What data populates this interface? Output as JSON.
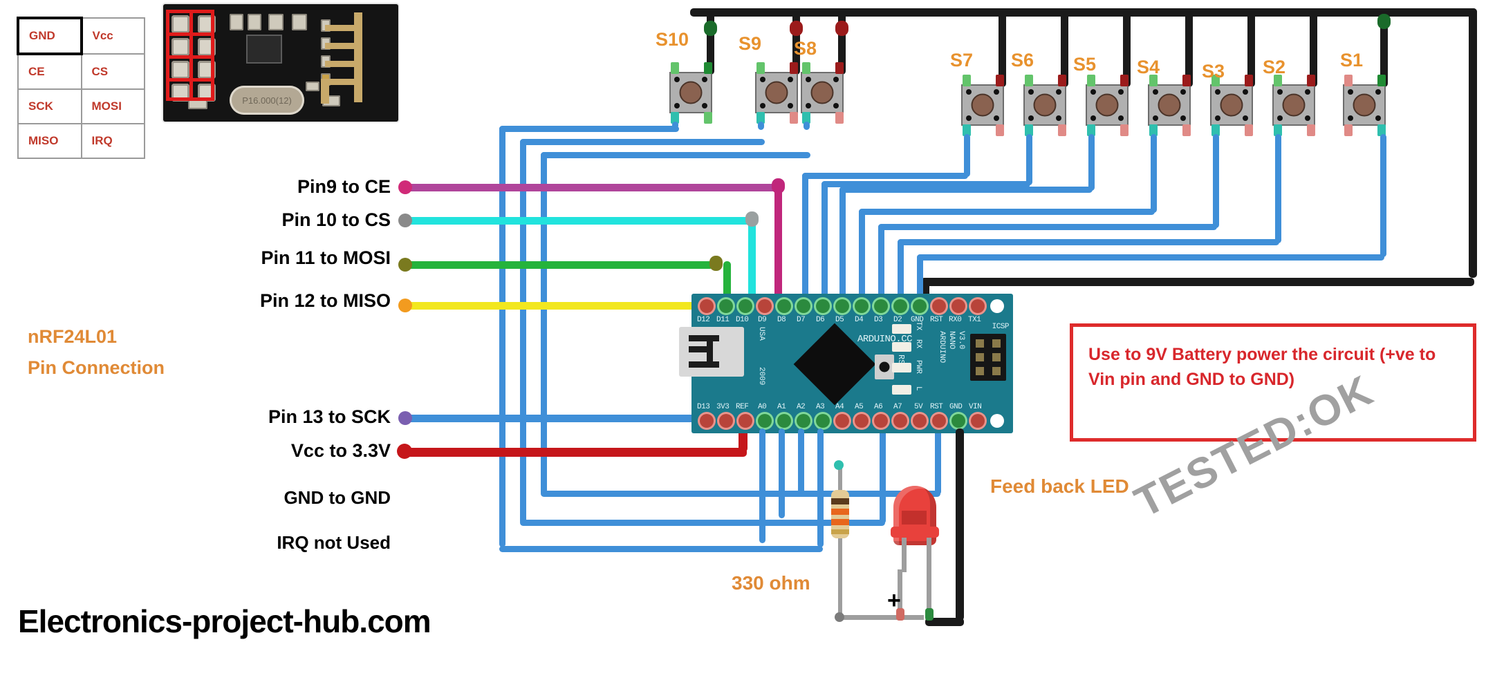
{
  "pin_table": {
    "rows": [
      [
        "GND",
        "Vcc"
      ],
      [
        "CE",
        "CS"
      ],
      [
        "SCK",
        "MOSI"
      ],
      [
        "MISO",
        "IRQ"
      ]
    ],
    "highlight_cell": "GND"
  },
  "module": {
    "crystal_marking": "P16.000(12)"
  },
  "section_title": {
    "line1": "nRF24L01",
    "line2": "Pin Connection"
  },
  "connections": [
    {
      "label": "Pin9 to CE",
      "color": "#b0459b"
    },
    {
      "label": "Pin 10 to CS",
      "color": "#21e3dd"
    },
    {
      "label": "Pin 11 to MOSI",
      "color": "#25b33c"
    },
    {
      "label": "Pin 12 to MISO",
      "color": "#f2e71f"
    },
    {
      "label": "Pin 13 to SCK",
      "color": "#3f8fd8"
    },
    {
      "label": "Vcc to 3.3V",
      "color": "#c5161a"
    },
    {
      "label": "GND to GND",
      "color": "#000000"
    },
    {
      "label": "IRQ not Used",
      "color": "#000000"
    }
  ],
  "switches": [
    {
      "name": "S10"
    },
    {
      "name": "S9"
    },
    {
      "name": "S8"
    },
    {
      "name": "S7"
    },
    {
      "name": "S6"
    },
    {
      "name": "S5"
    },
    {
      "name": "S4"
    },
    {
      "name": "S3"
    },
    {
      "name": "S2"
    },
    {
      "name": "S1"
    }
  ],
  "arduino": {
    "top_pins": [
      "D12",
      "D11",
      "D10",
      "D9",
      "D8",
      "D7",
      "D6",
      "D5",
      "D4",
      "D3",
      "D2",
      "GND",
      "RST",
      "RX0",
      "TX1"
    ],
    "bottom_pins": [
      "D13",
      "3V3",
      "REF",
      "A0",
      "A1",
      "A2",
      "A3",
      "A4",
      "A5",
      "A6",
      "A7",
      "5V",
      "RST",
      "GND",
      "VIN"
    ],
    "silk_brand": "ARDUINO.CC",
    "silk_country": "USA",
    "silk_year": "2009",
    "silk_model_1": "ARDUINO",
    "silk_model_2": "NANO",
    "silk_model_3": "V3.0",
    "silk_icsp": "ICSP",
    "silk_reset": "RST",
    "indicator_leds": [
      "TX",
      "RX",
      "PWR",
      "L"
    ]
  },
  "note_box": {
    "text": "Use  to 9V Battery power the circuit (+ve to Vin pin and GND to GND)",
    "border_color": "#de2b2b",
    "text_color": "#d8272c"
  },
  "annotations": {
    "resistor": "330 ohm",
    "led": "Feed back LED",
    "led_polarity": "+"
  },
  "watermark": "TESTED:OK",
  "footer": "Electronics-project-hub.com",
  "colors": {
    "orange": "#e8922e",
    "signal_blue": "#3f8fd8",
    "ground_black": "#1a1a1a",
    "vcc_red": "#c5161a",
    "board_teal": "#1b7a8c"
  }
}
